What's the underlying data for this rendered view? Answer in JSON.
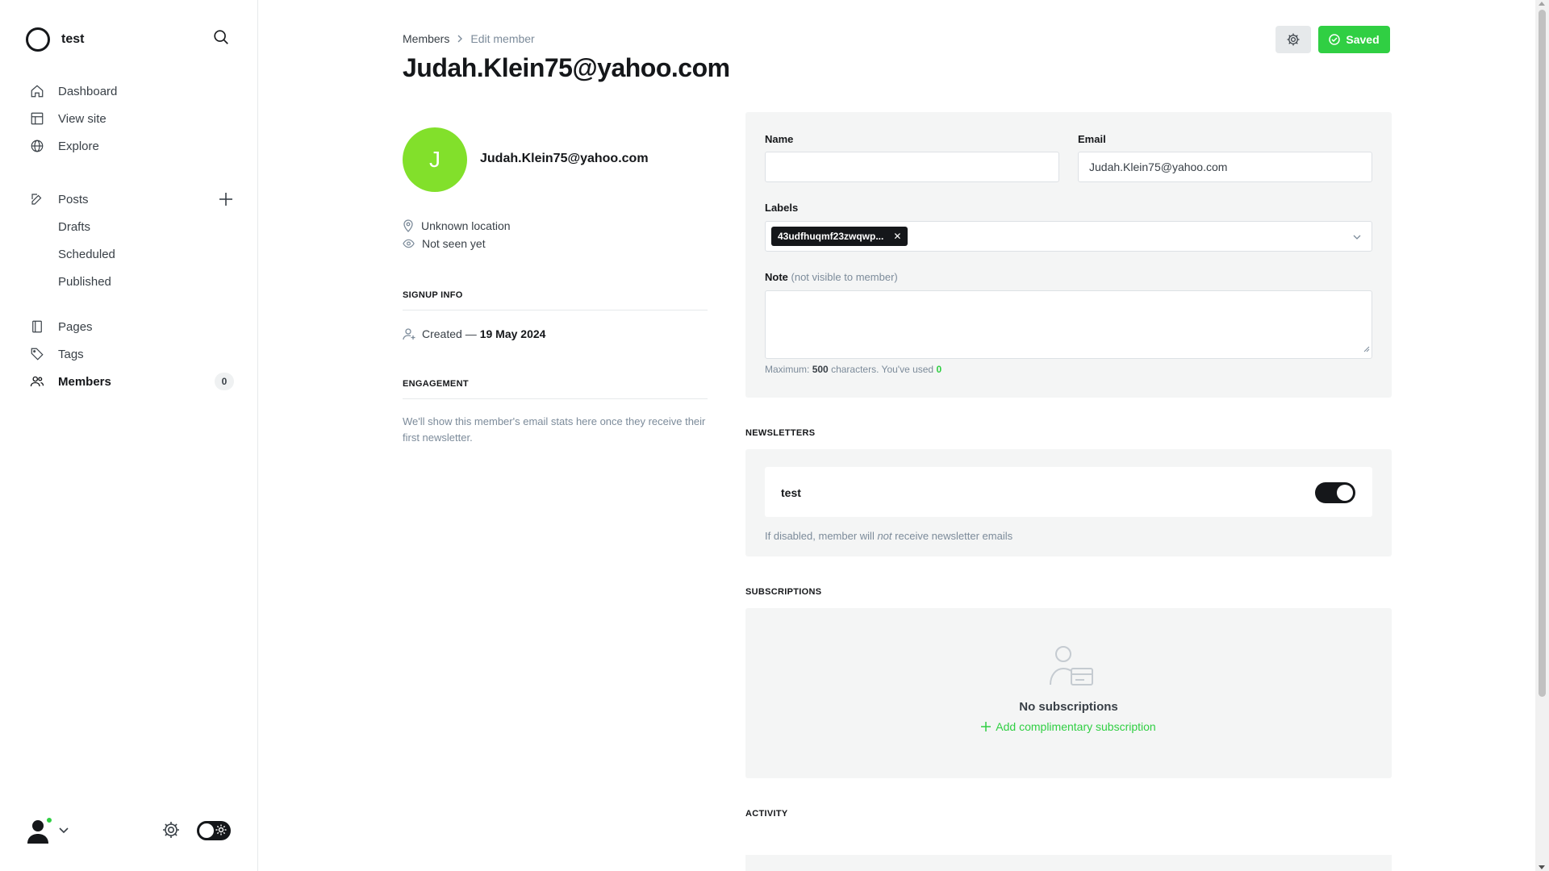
{
  "sidebar": {
    "brand": {
      "name": "test"
    },
    "nav_primary": [
      {
        "label": "Dashboard",
        "icon": "home-icon"
      },
      {
        "label": "View site",
        "icon": "layout-icon"
      },
      {
        "label": "Explore",
        "icon": "globe-icon"
      }
    ],
    "posts": {
      "label": "Posts",
      "sub_items": [
        "Drafts",
        "Scheduled",
        "Published"
      ]
    },
    "nav_secondary": [
      {
        "label": "Pages",
        "icon": "pages-icon"
      },
      {
        "label": "Tags",
        "icon": "tag-icon"
      },
      {
        "label": "Members",
        "icon": "members-icon",
        "count": "0",
        "active": true
      }
    ]
  },
  "header": {
    "breadcrumb": {
      "parent": "Members",
      "current": "Edit member"
    },
    "title": "Judah.Klein75@yahoo.com",
    "saved_label": "Saved"
  },
  "profile": {
    "initial": "J",
    "email": "Judah.Klein75@yahoo.com",
    "location": "Unknown location",
    "last_seen": "Not seen yet",
    "signup_heading": "SIGNUP INFO",
    "created_label": "Created —",
    "created_date": "19 May 2024",
    "engagement_heading": "ENGAGEMENT",
    "engagement_text": "We'll show this member's email stats here once they receive their first newsletter."
  },
  "form": {
    "name_label": "Name",
    "name_value": "",
    "email_label": "Email",
    "email_value": "Judah.Klein75@yahoo.com",
    "labels_label": "Labels",
    "label_chip": "43udfhuqmf23zwqwp...",
    "note_label": "Note",
    "note_hint": "(not visible to member)",
    "note_value": "",
    "max_prefix": "Maximum:",
    "max_count": "500",
    "max_mid": "characters. You've used",
    "used_count": "0"
  },
  "newsletters": {
    "heading": "NEWSLETTERS",
    "items": [
      {
        "name": "test",
        "enabled": true
      }
    ],
    "hint_prefix": "If disabled, member will",
    "hint_em": "not",
    "hint_suffix": "receive newsletter emails"
  },
  "subscriptions": {
    "heading": "SUBSCRIPTIONS",
    "empty_title": "No subscriptions",
    "add_label": "Add complimentary subscription"
  },
  "activity": {
    "heading": "ACTIVITY"
  },
  "colors": {
    "accent_green": "#30cf43",
    "avatar_green": "#82e02b",
    "text_dark": "#15171a",
    "muted": "#7c8b9a",
    "panel_bg": "#f4f5f5"
  }
}
